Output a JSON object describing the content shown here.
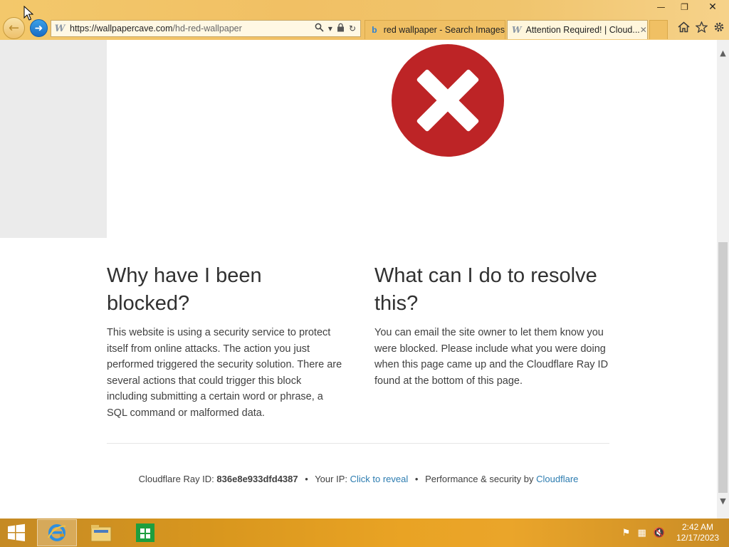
{
  "window": {
    "minimize": "—",
    "restore": "❐",
    "close": "✕"
  },
  "address": {
    "host": "https://wallpapercave.com",
    "path": "/hd-red-wallpaper"
  },
  "tabs": [
    {
      "title": "red wallpaper - Search Images",
      "icon": "bing-icon"
    },
    {
      "title": "Attention Required! | Cloud...",
      "icon": "wallpapercave-icon",
      "close": "✕"
    }
  ],
  "page": {
    "left": {
      "heading": "Why have I been blocked?",
      "body": "This website is using a security service to protect itself from online attacks. The action you just performed triggered the security solution. There are several actions that could trigger this block including submitting a certain word or phrase, a SQL command or malformed data."
    },
    "right": {
      "heading": "What can I do to resolve this?",
      "body": "You can email the site owner to let them know you were blocked. Please include what you were doing when this page came up and the Cloudflare Ray ID found at the bottom of this page."
    },
    "footer": {
      "ray_label": "Cloudflare Ray ID:",
      "ray_id": "836e8e933dfd4387",
      "bullet": "•",
      "ip_label": "Your IP:",
      "ip_link": "Click to reveal",
      "perf_label": "Performance & security by",
      "perf_link": "Cloudflare"
    }
  },
  "taskbar": {
    "time": "2:42 AM",
    "date": "12/17/2023"
  },
  "colors": {
    "error_red": "#bd2426",
    "link_blue": "#2c7cb0"
  }
}
